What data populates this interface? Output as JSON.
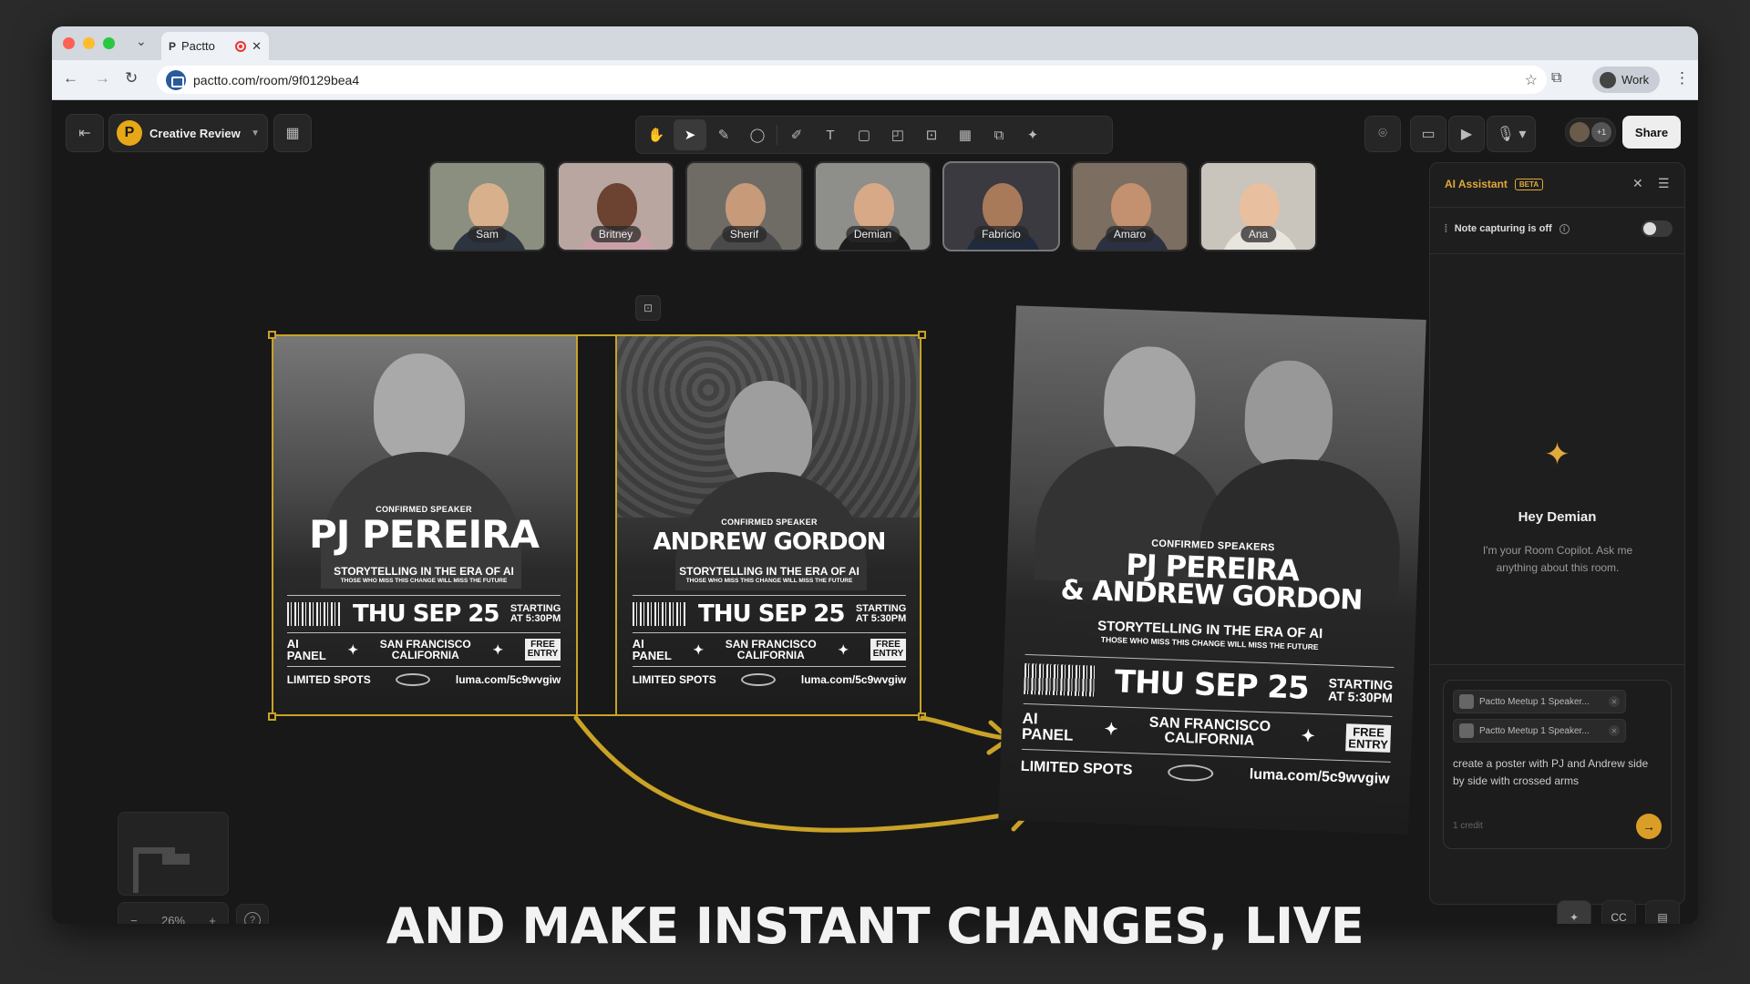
{
  "browser": {
    "tab_title": "Pactto",
    "tab_favicon": "P",
    "url": "pactto.com/room/9f0129bea4",
    "profile_label": "Work"
  },
  "room": {
    "logo_letter": "P",
    "name": "Creative Review"
  },
  "toolbar": {
    "tools": [
      {
        "icon": "hand-icon",
        "glyph": "✋",
        "active": false
      },
      {
        "icon": "pointer-icon",
        "glyph": "➤",
        "active": true
      },
      {
        "icon": "pen-icon",
        "glyph": "✎",
        "active": false
      },
      {
        "icon": "lasso-icon",
        "glyph": "◯",
        "active": false
      },
      {
        "sep": true
      },
      {
        "icon": "pencil-icon",
        "glyph": "✐",
        "active": false
      },
      {
        "icon": "text-icon",
        "glyph": "T",
        "active": false
      },
      {
        "icon": "shape-icon",
        "glyph": "▢",
        "active": false
      },
      {
        "icon": "sticky-note-icon",
        "glyph": "◰",
        "active": false
      },
      {
        "icon": "frame-icon",
        "glyph": "⊡",
        "active": false
      },
      {
        "icon": "table-icon",
        "glyph": "▦",
        "active": false
      },
      {
        "icon": "embed-icon",
        "glyph": "⧉",
        "active": false
      },
      {
        "icon": "ai-image-icon",
        "glyph": "✦",
        "active": false
      }
    ]
  },
  "header_right": {
    "extra_participants": "+1",
    "share_label": "Share"
  },
  "participants": [
    {
      "name": "Sam",
      "bg": "#8a8f80",
      "skin": "#d9b08c",
      "shirt": "#2c3440"
    },
    {
      "name": "Britney",
      "bg": "#b9a6a0",
      "skin": "#6b4330",
      "shirt": "#caa0a8"
    },
    {
      "name": "Sherif",
      "bg": "#6f6c66",
      "skin": "#c79a7a",
      "shirt": "#4a4a4a"
    },
    {
      "name": "Demian",
      "bg": "#8e8e8a",
      "skin": "#d8a987",
      "shirt": "#1c1c1c"
    },
    {
      "name": "Fabricio",
      "bg": "#3a3a40",
      "skin": "#a87a5a",
      "shirt": "#1f2a3d"
    },
    {
      "name": "Amaro",
      "bg": "#7c6e60",
      "skin": "#c39070",
      "shirt": "#2b3142"
    },
    {
      "name": "Ana",
      "bg": "#c9c4bc",
      "skin": "#e8c0a0",
      "shirt": "#e8e4de"
    }
  ],
  "posters": {
    "pj": {
      "conf": "CONFIRMED SPEAKER",
      "name": "PJ PEREIRA",
      "story": "STORYTELLING IN THE ERA OF AI",
      "tag": "THOSE WHO MISS THIS CHANGE WILL MISS THE FUTURE",
      "date": "THU SEP 25",
      "starting": "STARTING",
      "time": "AT 5:30PM",
      "ai": "AI",
      "panel": "PANEL",
      "city1": "SAN FRANCISCO",
      "city2": "CALIFORNIA",
      "free1": "FREE",
      "free2": "ENTRY",
      "spots": "LIMITED SPOTS",
      "url": "luma.com/5c9wvgiw"
    },
    "andrew": {
      "conf": "CONFIRMED SPEAKER",
      "name": "ANDREW GORDON",
      "story": "STORYTELLING IN THE ERA OF AI",
      "tag": "THOSE WHO MISS THIS CHANGE WILL MISS THE FUTURE",
      "date": "THU SEP 25",
      "starting": "STARTING",
      "time": "AT 5:30PM",
      "ai": "AI",
      "panel": "PANEL",
      "city1": "SAN FRANCISCO",
      "city2": "CALIFORNIA",
      "free1": "FREE",
      "free2": "ENTRY",
      "spots": "LIMITED SPOTS",
      "url": "luma.com/5c9wvgiw"
    },
    "combined": {
      "conf": "CONFIRMED SPEAKERS",
      "name1": "PJ PEREIRA",
      "name2": "& ANDREW GORDON",
      "story": "STORYTELLING IN THE ERA OF AI",
      "tag": "THOSE WHO MISS THIS CHANGE WILL MISS THE FUTURE",
      "date": "THU SEP 25",
      "starting": "STARTING",
      "time": "AT 5:30PM",
      "ai": "AI",
      "panel": "PANEL",
      "city1": "SAN FRANCISCO",
      "city2": "CALIFORNIA",
      "free1": "FREE",
      "free2": "ENTRY",
      "spots": "LIMITED SPOTS",
      "url": "luma.com/5c9wvgiw"
    }
  },
  "ai_assistant": {
    "title": "AI Assistant",
    "badge": "BETA",
    "note_capturing": "Note capturing is off",
    "greeting": "Hey Demian",
    "intro": "I'm your Room Copilot. Ask me anything about this room.",
    "attachments": [
      "Pactto Meetup 1 Speaker...",
      "Pactto Meetup 1 Speaker..."
    ],
    "prompt": "create a poster with PJ and Andrew side by side with crossed arms",
    "credit": "1 credit"
  },
  "zoom": {
    "minus": "−",
    "level": "26%",
    "plus": "+"
  },
  "caption": "AND MAKE INSTANT CHANGES, LIVE",
  "colors": {
    "accent": "#c9a227",
    "send": "#d99e26",
    "ai_title": "#e0a93a"
  }
}
